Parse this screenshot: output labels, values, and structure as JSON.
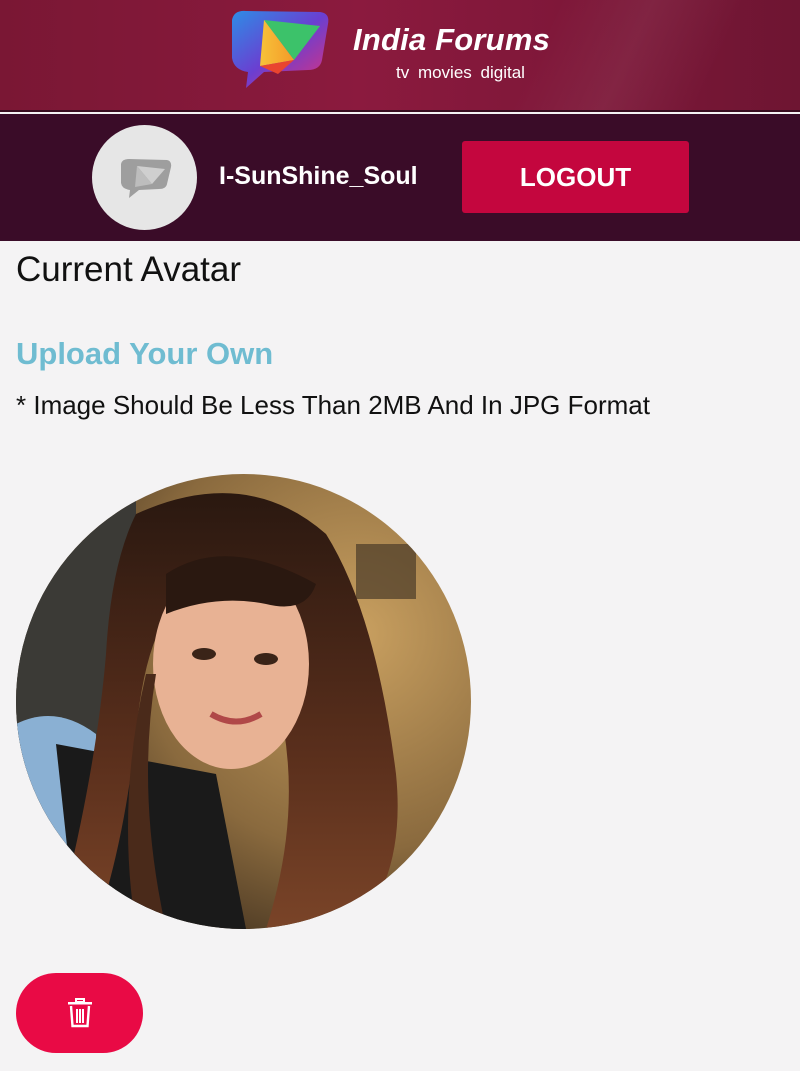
{
  "header": {
    "brand_name": "India Forums",
    "tagline": "tv  movies  digital"
  },
  "user": {
    "username": "I-SunShine_Soul",
    "logout_label": "LOGOUT"
  },
  "main": {
    "title": "Current Avatar",
    "upload_link": "Upload Your Own",
    "note": "* Image Should Be Less Than 2MB And In JPG Format"
  },
  "icons": {
    "delete": "trash-icon"
  },
  "colors": {
    "header_bg": "#7f1739",
    "userbar_bg": "#3a0c28",
    "logout_bg": "#c4063e",
    "link": "#6fbcd1",
    "delete_bg": "#e90a45",
    "page_bg": "#f4f3f4"
  }
}
